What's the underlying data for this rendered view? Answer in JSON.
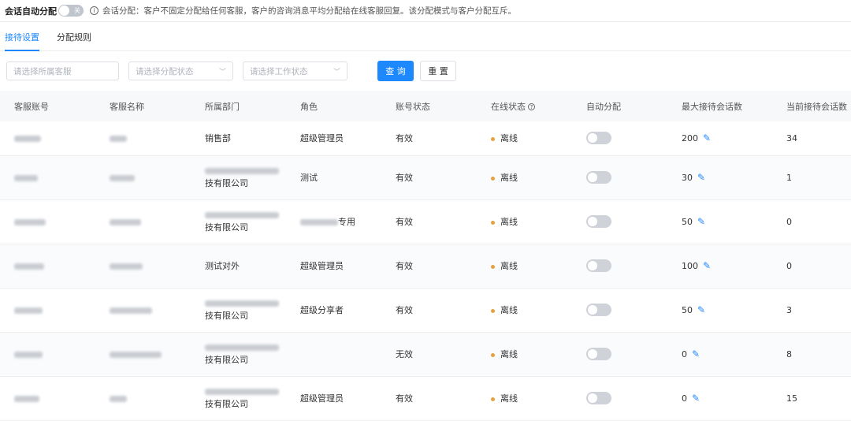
{
  "header": {
    "title": "会话自动分配",
    "toggle_label": "关",
    "description": "会话分配：客户不固定分配给任何客服，客户的咨询消息平均分配给在线客服回复。该分配模式与客户分配互斥。"
  },
  "tabs": [
    {
      "label": "接待设置",
      "active": true
    },
    {
      "label": "分配规则",
      "active": false
    }
  ],
  "filters": {
    "agent_placeholder": "请选择所属客服",
    "assign_status_placeholder": "请选择分配状态",
    "work_status_placeholder": "请选择工作状态",
    "query_label": "查 询",
    "reset_label": "重 置"
  },
  "table": {
    "columns": [
      "客服账号",
      "客服名称",
      "所属部门",
      "角色",
      "账号状态",
      "在线状态",
      "自动分配",
      "最大接待会话数",
      "当前接待会话数"
    ],
    "rows": [
      {
        "account": "",
        "name": "",
        "dept": "销售部",
        "dept_suffix": "",
        "role": "超级管理员",
        "role_suffix": "",
        "account_status": "有效",
        "online": "离线",
        "auto": false,
        "max": "200",
        "current": "34"
      },
      {
        "account": "",
        "name": "",
        "dept": "",
        "dept_suffix": "技有限公司",
        "role": "测试",
        "role_suffix": "",
        "account_status": "有效",
        "online": "离线",
        "auto": false,
        "max": "30",
        "current": "1"
      },
      {
        "account": "",
        "name": "",
        "dept": "",
        "dept_suffix": "技有限公司",
        "role": "",
        "role_suffix": "专用",
        "account_status": "有效",
        "online": "离线",
        "auto": false,
        "max": "50",
        "current": "0"
      },
      {
        "account": "",
        "name": "",
        "dept": "测试对外",
        "dept_suffix": "",
        "role": "超级管理员",
        "role_suffix": "",
        "account_status": "有效",
        "online": "离线",
        "auto": false,
        "max": "100",
        "current": "0"
      },
      {
        "account": "",
        "name": "",
        "dept": "",
        "dept_suffix": "技有限公司",
        "role": "超级分享者",
        "role_suffix": "",
        "account_status": "有效",
        "online": "离线",
        "auto": false,
        "max": "50",
        "current": "3"
      },
      {
        "account": "",
        "name": "",
        "dept": "",
        "dept_suffix": "技有限公司",
        "role": "",
        "role_suffix": "",
        "account_status": "无效",
        "online": "离线",
        "auto": false,
        "max": "0",
        "current": "8"
      },
      {
        "account": "",
        "name": "",
        "dept": "",
        "dept_suffix": "技有限公司",
        "role": "超级管理员",
        "role_suffix": "",
        "account_status": "有效",
        "online": "离线",
        "auto": false,
        "max": "0",
        "current": "15"
      }
    ]
  },
  "colors": {
    "accent": "#1e88ff",
    "offline_dot": "#e6a23c"
  },
  "icons": {
    "info": "info-circle-icon",
    "help": "question-circle-icon",
    "edit": "pencil-icon",
    "dropdown": "chevron-down-icon"
  }
}
